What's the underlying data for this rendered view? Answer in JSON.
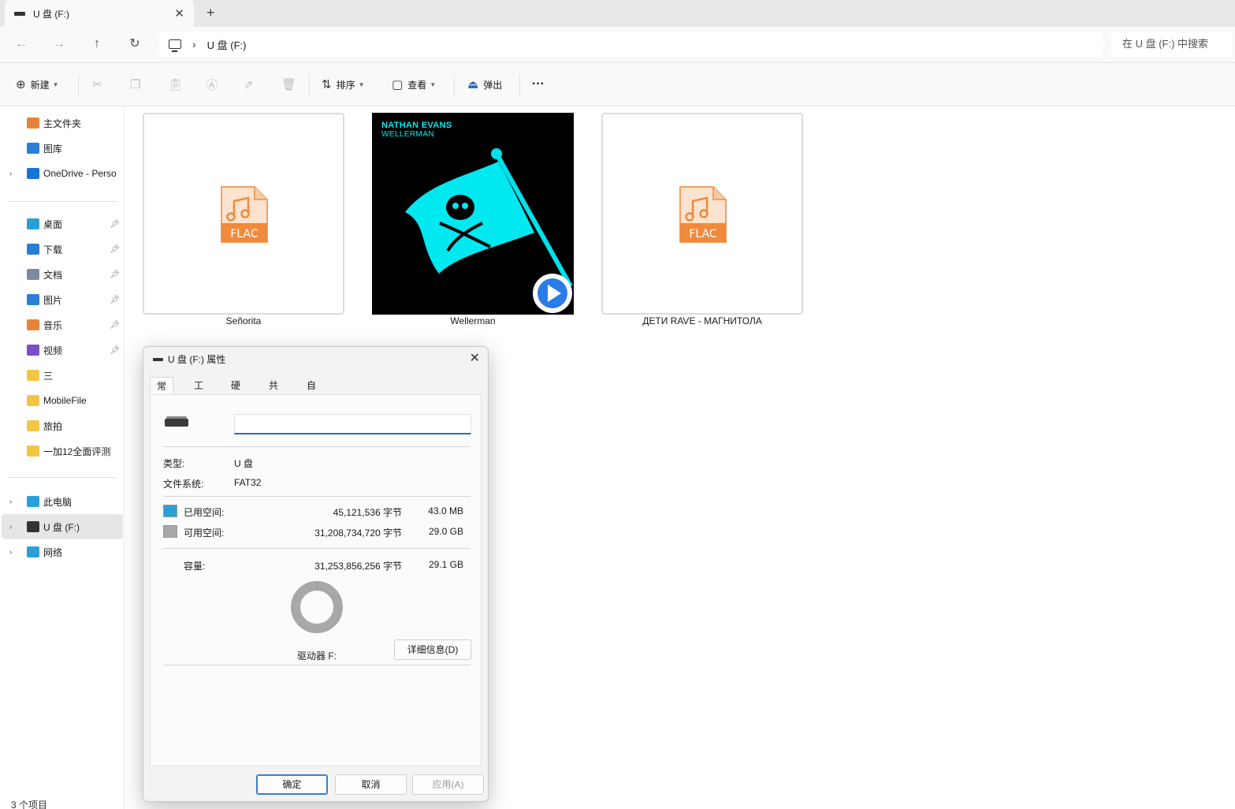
{
  "window": {
    "tab_title": "U 盘 (F:)",
    "tab_close": "✕",
    "new_tab": "+"
  },
  "address": {
    "crumb_sep": "›",
    "crumb": "U 盘 (F:)",
    "search_placeholder": "在 U 盘 (F:) 中搜索"
  },
  "toolbar": {
    "new": "新建",
    "sort": "排序",
    "view": "查看",
    "eject": "弹出",
    "more": "···"
  },
  "sidebar": {
    "top": [
      {
        "label": "主文件夹",
        "color": "#e8833a"
      },
      {
        "label": "图库",
        "color": "#2a7fd4"
      },
      {
        "label": "OneDrive - Perso",
        "color": "#1a73d9"
      }
    ],
    "pinned": [
      {
        "label": "桌面",
        "color": "#2aa1d6"
      },
      {
        "label": "下载",
        "color": "#2a7fd4"
      },
      {
        "label": "文档",
        "color": "#7b8aa0"
      },
      {
        "label": "图片",
        "color": "#2a7fd4"
      },
      {
        "label": "音乐",
        "color": "#e8833a"
      },
      {
        "label": "视频",
        "color": "#7a4fc8"
      },
      {
        "label": "三",
        "color": "#f4c542"
      },
      {
        "label": "MobileFile",
        "color": "#f4c542"
      },
      {
        "label": "旅拍",
        "color": "#f4c542"
      },
      {
        "label": "一加12全面评测",
        "color": "#f4c542"
      }
    ],
    "devices": [
      {
        "label": "此电脑",
        "color": "#2aa1d6"
      },
      {
        "label": "U 盘 (F:)",
        "color": "#333333"
      },
      {
        "label": "网络",
        "color": "#2aa1d6"
      }
    ]
  },
  "files": [
    {
      "name": "Señorita",
      "type": "FLAC"
    },
    {
      "name": "Wellerman",
      "type": "art",
      "artist": "NATHAN EVANS",
      "song": "WELLERMAN"
    },
    {
      "name": "ДЕТИ RAVE - МАГНИТОЛА",
      "type": "FLAC"
    }
  ],
  "status": "3 个项目",
  "dialog": {
    "title": "U 盘 (F:) 属性",
    "close": "✕",
    "tabs": [
      "常规",
      "工具",
      "硬件",
      "共享",
      "自定义"
    ],
    "type_label": "类型:",
    "type_value": "U 盘",
    "fs_label": "文件系统:",
    "fs_value": "FAT32",
    "used_label": "已用空间:",
    "used_bytes": "45,121,536 字节",
    "used_size": "43.0 MB",
    "free_label": "可用空间:",
    "free_bytes": "31,208,734,720 字节",
    "free_size": "29.0 GB",
    "cap_label": "容量:",
    "cap_bytes": "31,253,856,256 字节",
    "cap_size": "29.1 GB",
    "used_fraction": 0.0014,
    "drive_label": "驱动器 F:",
    "details_button": "详细信息(D)",
    "ok": "确定",
    "cancel": "取消",
    "apply": "应用(A)",
    "used_color": "#2a9fd8",
    "free_color": "#a8a8a8"
  }
}
